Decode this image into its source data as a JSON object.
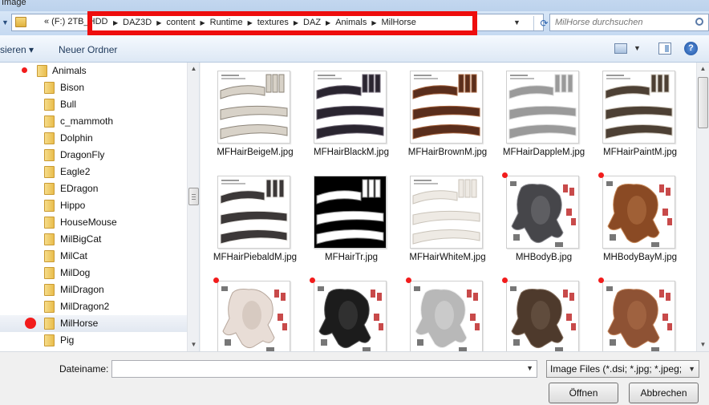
{
  "window": {
    "title": "Image"
  },
  "address": {
    "drive": "« (F:) 2TB_HDD",
    "crumbs": [
      "DAZ3D",
      "content",
      "Runtime",
      "textures",
      "DAZ",
      "Animals",
      "MilHorse"
    ]
  },
  "search": {
    "placeholder": "MilHorse durchsuchen"
  },
  "toolbar": {
    "organize_label": "sieren ▾",
    "new_folder_label": "Neuer Ordner"
  },
  "sidebar": {
    "parent": "Animals",
    "items": [
      "Bison",
      "Bull",
      "c_mammoth",
      "Dolphin",
      "DragonFly",
      "Eagle2",
      "EDragon",
      "Hippo",
      "HouseMouse",
      "MilBigCat",
      "MilCat",
      "MilDog",
      "MilDragon",
      "MilDragon2",
      "MilHorse",
      "Pig"
    ],
    "selected": "MilHorse"
  },
  "files": [
    {
      "name": "MFHairBeigeM.jpg",
      "kind": "hair",
      "color": "#d8d2c8",
      "accent": "#8d857a"
    },
    {
      "name": "MFHairBlackM.jpg",
      "kind": "hair",
      "color": "#2a2530",
      "accent": "#6a6270"
    },
    {
      "name": "MFHairBrownM.jpg",
      "kind": "hair",
      "color": "#5a2e1c",
      "accent": "#a4603a"
    },
    {
      "name": "MFHairDappleM.jpg",
      "kind": "hair",
      "color": "#9a9a9a",
      "accent": "#d8d8d8"
    },
    {
      "name": "MFHairPaintM.jpg",
      "kind": "hair",
      "color": "#4d4034",
      "accent": "#cfc8bd"
    },
    {
      "name": "MFHairPiebaldM.jpg",
      "kind": "hair",
      "color": "#3c3838",
      "accent": "#e8e6e2"
    },
    {
      "name": "MFHairTr.jpg",
      "kind": "hairdark",
      "color": "#ffffff",
      "accent": "#8a8a8a"
    },
    {
      "name": "MFHairWhiteM.jpg",
      "kind": "hair",
      "color": "#eeeae4",
      "accent": "#c9c3b9"
    },
    {
      "name": "MHBodyB.jpg",
      "kind": "body",
      "color": "#46464a",
      "accent": "#8b8b90"
    },
    {
      "name": "MHBodyBayM.jpg",
      "kind": "body",
      "color": "#8a4a24",
      "accent": "#c88a5a"
    },
    {
      "name": "",
      "kind": "body",
      "color": "#e8ddd6",
      "accent": "#b7a79c"
    },
    {
      "name": "",
      "kind": "body",
      "color": "#1c1c1c",
      "accent": "#555555"
    },
    {
      "name": "",
      "kind": "body",
      "color": "#b8b8b8",
      "accent": "#ececec"
    },
    {
      "name": "",
      "kind": "body",
      "color": "#4e3a2c",
      "accent": "#85705f"
    },
    {
      "name": "",
      "kind": "body",
      "color": "#8e5234",
      "accent": "#c08058"
    }
  ],
  "bottom": {
    "filename_label": "Dateiname:",
    "filename_value": "",
    "filetype": "Image Files (*.dsi; *.jpg; *.jpeg;",
    "open_label": "Öffnen",
    "cancel_label": "Abbrechen"
  },
  "colors": {
    "highlight": "#ee0d0d",
    "marker": "#f21c1c"
  }
}
